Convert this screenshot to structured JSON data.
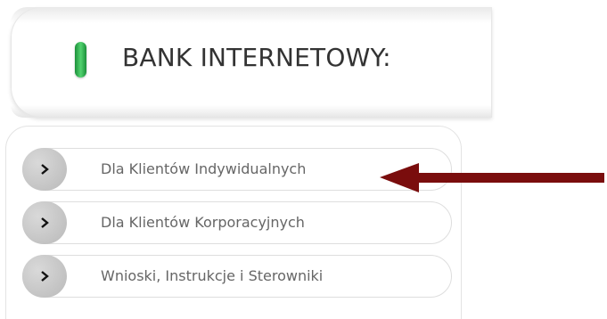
{
  "header": {
    "title": "BANK INTERNETOWY:"
  },
  "menu": {
    "items": [
      {
        "label": "Dla Klientów Indywidualnych"
      },
      {
        "label": "Dla Klientów Korporacyjnych"
      },
      {
        "label": "Wnioski, Instrukcje i Sterowniki"
      }
    ]
  },
  "colors": {
    "indicator_green": "#1b8f3a",
    "annotation_arrow": "#7a0d0d",
    "bullet_gray": "#c4c4c4"
  }
}
